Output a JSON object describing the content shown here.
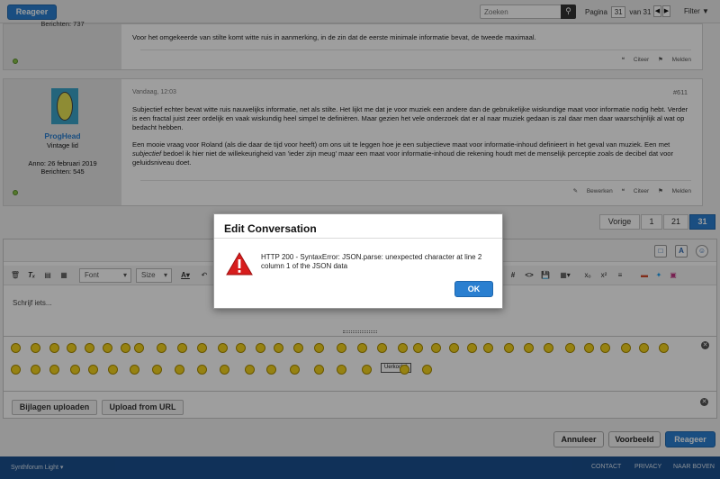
{
  "topbar": {
    "reply_label": "Reageer",
    "search_placeholder": "Zoeken",
    "page_word": "Pagina",
    "current_page": "31",
    "of_label": "van 31",
    "filter_label": "Filter"
  },
  "post1": {
    "truncated_header": "Berichten: 737",
    "text": "Voor het omgekeerde van stilte komt witte ruis in aanmerking, in de zin dat de eerste minimale informatie bevat, de tweede maximaal.",
    "actions": [
      "Citeer",
      "Melden"
    ]
  },
  "post2": {
    "username": "ProgHead",
    "role": "Vintage lid",
    "joined": "Anno: 26 februari 2019",
    "posts": "Berichten: 545",
    "date": "Vandaag, 12:03",
    "number": "#611",
    "para1": "Subjectief echter bevat witte ruis nauwelijks informatie, net als stilte. Het lijkt me dat je voor muziek een andere dan de gebruikelijke wiskundige maat voor informatie nodig hebt. Verder is een fractal juist zeer ordelijk en vaak wiskundig heel simpel te definiëren. Maar gezien het vele onderzoek dat er al naar muziek gedaan is zal daar men daar waarschijnlijk al wat op bedacht hebben.",
    "para2_a": "Een mooie vraag voor Roland (als die daar de tijd voor heeft) om ons uit te leggen hoe je een subjectieve maat voor informatie-inhoud definieert in het geval van muziek. Een met ",
    "para2_em": "subjectief",
    "para2_b": " bedoel ik hier niet de willekeurigheid van 'ieder zijn meug' maar een maat voor informatie-inhoud die rekening houdt met de menselijk perceptie zoals de decibel dat voor geluidsniveau doet.",
    "actions": [
      "Bewerken",
      "Citeer",
      "Melden"
    ]
  },
  "pagination": [
    "Vorige",
    "1",
    "21",
    "31"
  ],
  "editor": {
    "font_label": "Font",
    "size_label": "Size",
    "placeholder": "Schrijf iets..."
  },
  "smilie_label": "Uerkocht!",
  "attach": {
    "upload_label": "Bijlagen uploaden",
    "url_label": "Upload from URL"
  },
  "bottom": {
    "cancel_label": "Annuleer",
    "preview_label": "Voorbeeld",
    "reply_label": "Reageer"
  },
  "footer": {
    "style_label": "Synthforum Light",
    "links": [
      "CONTACT",
      "PRIVACY",
      "NAAR BOVEN"
    ]
  },
  "dialog": {
    "title": "Edit Conversation",
    "message": "HTTP 200 - SyntaxError: JSON.parse: unexpected character at line 2 column 1 of the JSON data",
    "ok_label": "OK"
  },
  "colors": {
    "accent": "#2a7fd0",
    "footer": "#1a4f8f",
    "warning": "#d71d1d"
  }
}
